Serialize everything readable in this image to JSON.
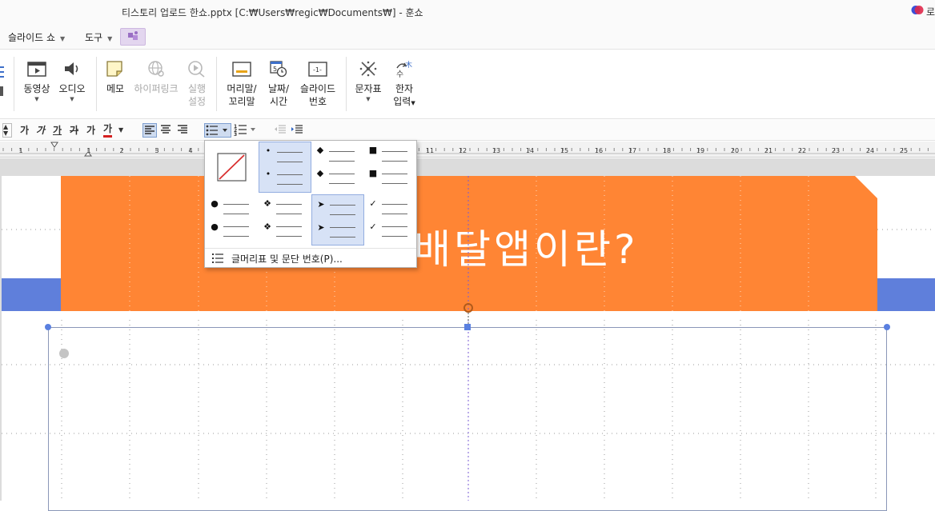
{
  "window": {
    "title": "티스토리 업로드 한쇼.pptx [C:₩Users₩regic₩Documents₩] - 훈쇼",
    "login_label": "로"
  },
  "menu": {
    "items": [
      {
        "label": "슬라이드 쇼"
      },
      {
        "label": "도구"
      }
    ]
  },
  "ribbon": {
    "video": "동영상",
    "audio": "오디오",
    "memo": "메모",
    "hyperlink": "하이퍼링크",
    "run_line1": "실행",
    "run_line2": "설정",
    "header_line1": "머리말/",
    "header_line2": "꼬리말",
    "date_line1": "날짜/",
    "date_line2": "시간",
    "slideno_line1": "슬라이드",
    "slideno_line2": "번호",
    "charmap": "문자표",
    "hanja_line1": "한자",
    "hanja_line2": "입력"
  },
  "format_toolbar": {
    "ga1": "가",
    "ga2": "가",
    "ga3": "가",
    "ga4": "가",
    "ga5": "가",
    "ga6": "가"
  },
  "ruler": {
    "marks": [
      "1",
      "1",
      "1",
      "2",
      "3",
      "4",
      "11",
      "12",
      "13",
      "14",
      "15",
      "16",
      "17",
      "18",
      "19",
      "20",
      "21",
      "22",
      "23",
      "24",
      "25"
    ]
  },
  "slide": {
    "title": "배달앱이란?"
  },
  "bullet_menu": {
    "footer_label": "글머리표 및 문단 번호(P)...",
    "symbols": [
      "•",
      "◆",
      "■",
      "●",
      "❖",
      "➤",
      "✓"
    ]
  },
  "colors": {
    "orange": "#ff8534",
    "blue_band": "#5f7fdb",
    "selection": "#d7e2f6"
  }
}
